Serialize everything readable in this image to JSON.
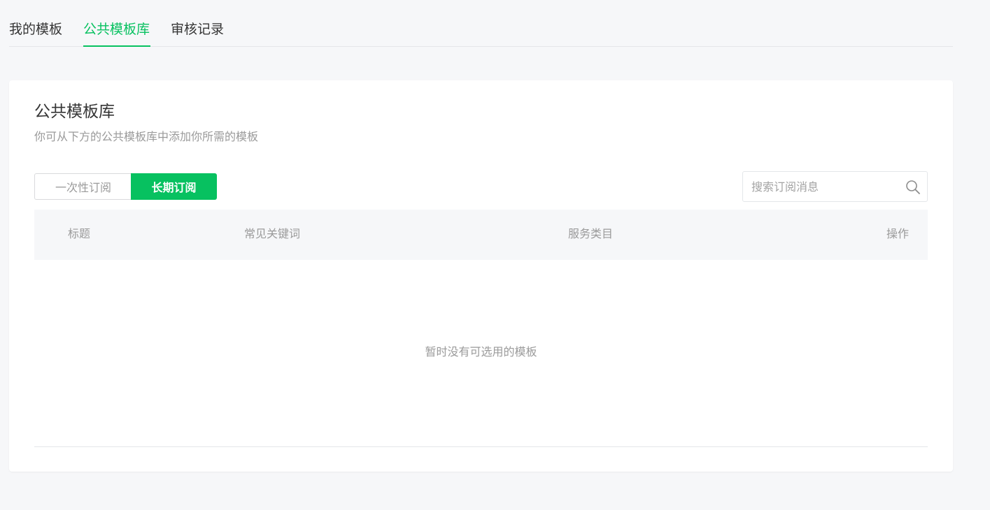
{
  "tabs": [
    {
      "label": "我的模板",
      "active": false
    },
    {
      "label": "公共模板库",
      "active": true
    },
    {
      "label": "审核记录",
      "active": false
    }
  ],
  "colors": {
    "accent": "#07c160",
    "page_bg": "#f6f7f9",
    "text": "#353535",
    "muted": "#9a9a9a"
  },
  "card": {
    "title": "公共模板库",
    "description": "你可从下方的公共模板库中添加你所需的模板"
  },
  "subscription_toggle": {
    "options": [
      "一次性订阅",
      "长期订阅"
    ],
    "selected": "长期订阅"
  },
  "search": {
    "placeholder": "搜索订阅消息",
    "value": "",
    "icon": "search-icon"
  },
  "table": {
    "columns": [
      "标题",
      "常见关键词",
      "服务类目",
      "操作"
    ],
    "rows": [],
    "empty_text": "暂时没有可选用的模板"
  }
}
